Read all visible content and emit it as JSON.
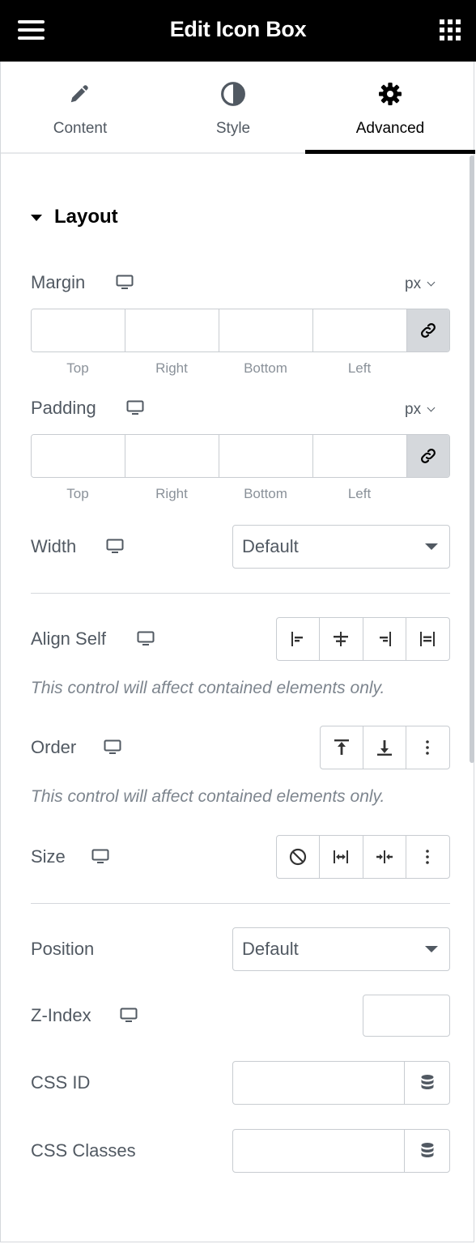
{
  "header": {
    "title": "Edit Icon Box",
    "menu_icon": "hamburger-icon",
    "apps_icon": "grid-icon"
  },
  "tabs": [
    {
      "label": "Content",
      "icon": "pencil-icon",
      "active": false
    },
    {
      "label": "Style",
      "icon": "half-circle-icon",
      "active": false
    },
    {
      "label": "Advanced",
      "icon": "gear-icon",
      "active": true
    }
  ],
  "section": {
    "title": "Layout"
  },
  "margin": {
    "label": "Margin",
    "unit": "px",
    "fields": [
      "Top",
      "Right",
      "Bottom",
      "Left"
    ]
  },
  "padding": {
    "label": "Padding",
    "unit": "px",
    "fields": [
      "Top",
      "Right",
      "Bottom",
      "Left"
    ]
  },
  "width": {
    "label": "Width",
    "value": "Default"
  },
  "align_self": {
    "label": "Align Self",
    "note": "This control will affect contained elements only."
  },
  "order": {
    "label": "Order",
    "note": "This control will affect contained elements only."
  },
  "size": {
    "label": "Size"
  },
  "position": {
    "label": "Position",
    "value": "Default"
  },
  "z_index": {
    "label": "Z-Index"
  },
  "css_id": {
    "label": "CSS ID"
  },
  "css_classes": {
    "label": "CSS Classes"
  },
  "colors": {
    "header_bg": "#000000",
    "text": "#515962",
    "border": "#c8ccd1",
    "active_tab": "#000000"
  }
}
